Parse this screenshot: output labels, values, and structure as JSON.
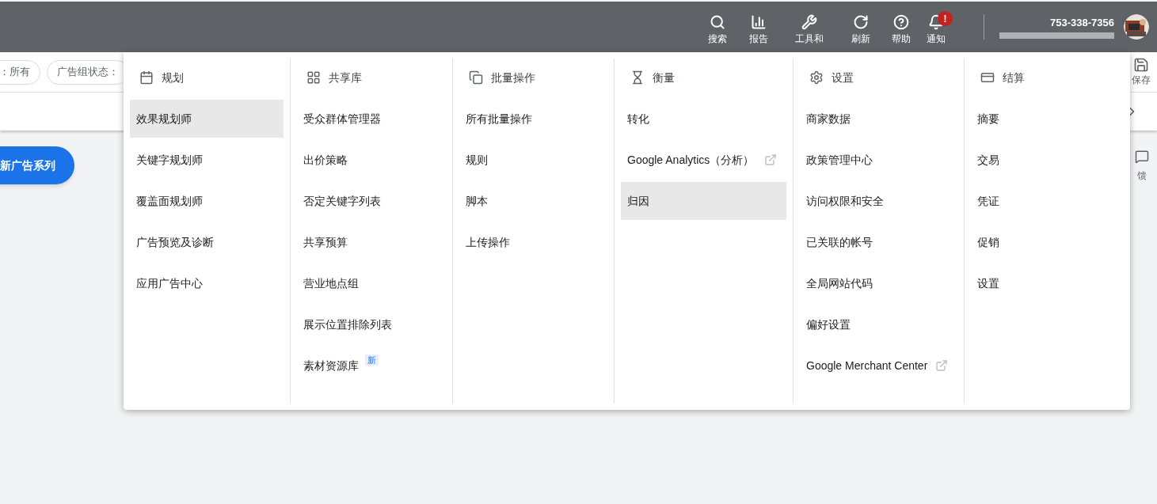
{
  "top_bar": {
    "tools": [
      {
        "label": "搜索"
      },
      {
        "label": "报告"
      },
      {
        "label": "工具和"
      },
      {
        "label": "刷新"
      },
      {
        "label": "帮助"
      },
      {
        "label": "通知",
        "badge": "!"
      }
    ],
    "account": {
      "phone": "753-338-7356"
    }
  },
  "filters": [
    "：所有",
    "广告组状态："
  ],
  "save_button": "保存",
  "new_campaign_button": "新广告系列",
  "feedback_button": "馈",
  "menu": {
    "columns": [
      {
        "title": "规划",
        "items": [
          {
            "label": "效果规划师",
            "selected": true,
            "external": false
          },
          {
            "label": "关键字规划师",
            "selected": false,
            "external": false
          },
          {
            "label": "覆盖面规划师",
            "selected": false,
            "external": false
          },
          {
            "label": "广告预览及诊断",
            "selected": false,
            "external": false
          },
          {
            "label": "应用广告中心",
            "selected": false,
            "external": false
          }
        ]
      },
      {
        "title": "共享库",
        "items": [
          {
            "label": "受众群体管理器",
            "selected": false,
            "external": false
          },
          {
            "label": "出价策略",
            "selected": false,
            "external": false
          },
          {
            "label": "否定关键字列表",
            "selected": false,
            "external": false
          },
          {
            "label": "共享预算",
            "selected": false,
            "external": false
          },
          {
            "label": "营业地点组",
            "selected": false,
            "external": false
          },
          {
            "label": "展示位置排除列表",
            "selected": false,
            "external": false
          },
          {
            "label": "素材资源库",
            "selected": false,
            "external": false,
            "badge": "新"
          }
        ]
      },
      {
        "title": "批量操作",
        "items": [
          {
            "label": "所有批量操作",
            "selected": false,
            "external": false
          },
          {
            "label": "规则",
            "selected": false,
            "external": false
          },
          {
            "label": "脚本",
            "selected": false,
            "external": false
          },
          {
            "label": "上传操作",
            "selected": false,
            "external": false
          }
        ]
      },
      {
        "title": "衡量",
        "items": [
          {
            "label": "转化",
            "selected": false,
            "external": false
          },
          {
            "label": "Google Analytics（分析）",
            "selected": false,
            "external": true
          },
          {
            "label": "归因",
            "selected": true,
            "external": false
          }
        ]
      },
      {
        "title": "设置",
        "items": [
          {
            "label": "商家数据",
            "selected": false,
            "external": false
          },
          {
            "label": "政策管理中心",
            "selected": false,
            "external": false
          },
          {
            "label": "访问权限和安全",
            "selected": false,
            "external": false
          },
          {
            "label": "已关联的帐号",
            "selected": false,
            "external": false
          },
          {
            "label": "全局网站代码",
            "selected": false,
            "external": false
          },
          {
            "label": "偏好设置",
            "selected": false,
            "external": false
          },
          {
            "label": "Google Merchant Center",
            "selected": false,
            "external": true
          }
        ]
      },
      {
        "title": "结算",
        "items": [
          {
            "label": "摘要",
            "selected": false,
            "external": false
          },
          {
            "label": "交易",
            "selected": false,
            "external": false
          },
          {
            "label": "凭证",
            "selected": false,
            "external": false
          },
          {
            "label": "促销",
            "selected": false,
            "external": false
          },
          {
            "label": "设置",
            "selected": false,
            "external": false
          }
        ]
      }
    ]
  }
}
